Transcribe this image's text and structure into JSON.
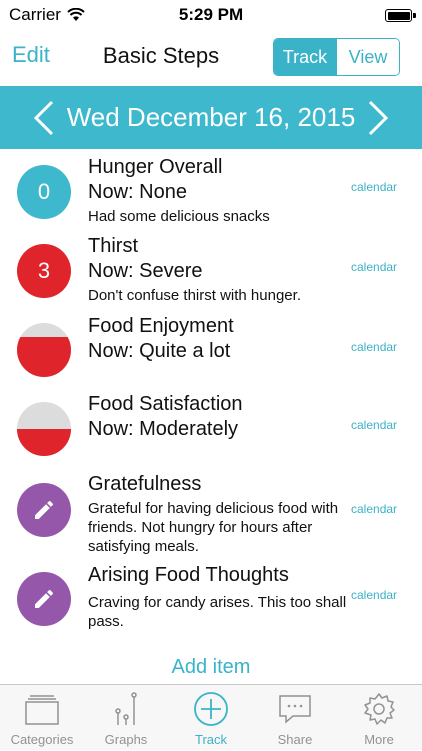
{
  "status_bar": {
    "carrier": "Carrier",
    "time": "5:29 PM"
  },
  "nav": {
    "edit": "Edit",
    "title": "Basic Steps",
    "segments": [
      "Track",
      "View"
    ]
  },
  "date": {
    "text": "Wed December 16, 2015"
  },
  "items": [
    {
      "title": "Hunger Overall",
      "now": "Now: None",
      "note": "Had some delicious snacks",
      "indicator": "0",
      "indicator_color": "#3db8cd",
      "calendar": "calendar"
    },
    {
      "title": "Thirst",
      "now": "Now: Severe",
      "note": "Don't confuse thirst with hunger.",
      "indicator": "3",
      "indicator_color": "#e0242b",
      "calendar": "calendar"
    },
    {
      "title": "Food Enjoyment",
      "now": "Now: Quite a lot",
      "level": 0.75,
      "calendar": "calendar"
    },
    {
      "title": "Food Satisfaction",
      "now": "Now: Moderately",
      "level": 0.5,
      "calendar": "calendar"
    },
    {
      "title": "Gratefulness",
      "note": "Grateful for having delicious food with friends. Not hungry for hours after satisfying meals.",
      "icon": "pencil-icon",
      "calendar": "calendar"
    },
    {
      "title": "Arising Food Thoughts",
      "note": "Craving for candy arises. This too shall pass.",
      "icon": "pencil-icon",
      "calendar": "calendar"
    }
  ],
  "add_item": "Add item",
  "tabs": [
    {
      "label": "Categories",
      "icon": "categories-icon"
    },
    {
      "label": "Graphs",
      "icon": "graphs-icon"
    },
    {
      "label": "Track",
      "icon": "add-circle-icon",
      "selected": true
    },
    {
      "label": "Share",
      "icon": "share-icon"
    },
    {
      "label": "More",
      "icon": "gear-icon"
    }
  ],
  "colors": {
    "accent": "#3ab3c8",
    "red": "#e0242b",
    "purple": "#9457aa",
    "grey": "#dcdcdc"
  }
}
